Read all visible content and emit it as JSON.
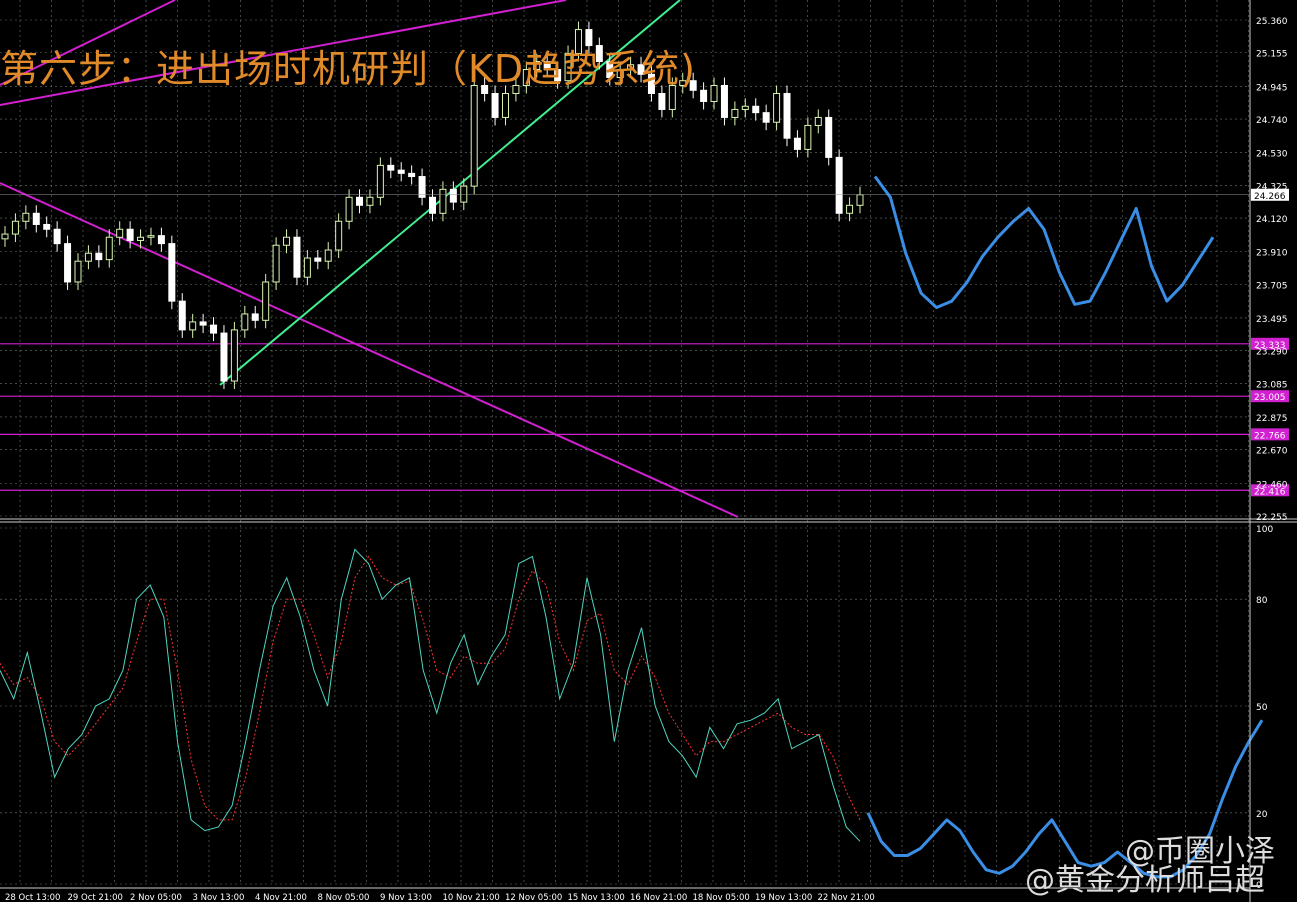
{
  "title": "第六步：进出场时机研判（KD趋势系统)",
  "watermark": {
    "line1": "@币圈小泽",
    "line2": "@黄金分析师吕超"
  },
  "colors": {
    "bg": "#000000",
    "grid": "#6b7a6b",
    "up": "#d8f5b0",
    "down": "#ffffff",
    "magenta": "#d020d0",
    "trend": "#40f090",
    "forecast": "#3a8ee6",
    "k_line": "#4fd6c0",
    "d_line": "#ff3030",
    "axis_text": "#ffffff",
    "title": "#e08a2a"
  },
  "chart_data": [
    {
      "type": "candlestick",
      "price_axis": {
        "ylim": [
          22.255,
          25.36
        ],
        "ticks": [
          "25.360",
          "25.155",
          "24.945",
          "24.740",
          "24.530",
          "24.325",
          "24.120",
          "23.910",
          "23.705",
          "23.495",
          "23.290",
          "23.085",
          "22.875",
          "22.670",
          "22.460",
          "22.255"
        ],
        "current_price": "24.266"
      },
      "x_labels": [
        "28 Oct 13:00",
        "29 Oct 21:00",
        "2 Nov 05:00",
        "3 Nov 13:00",
        "4 Nov 21:00",
        "8 Nov 05:00",
        "9 Nov 13:00",
        "10 Nov 21:00",
        "12 Nov 05:00",
        "15 Nov 13:00",
        "16 Nov 21:00",
        "18 Nov 05:00",
        "19 Nov 13:00",
        "22 Nov 21:00"
      ],
      "horizontal_levels": [
        {
          "label": "23.333",
          "value": 23.333
        },
        {
          "label": "23.005",
          "value": 23.005
        },
        {
          "label": "22.766",
          "value": 22.766
        },
        {
          "label": "22.416",
          "value": 22.416
        }
      ],
      "closes": [
        24.02,
        24.1,
        24.15,
        24.08,
        24.05,
        23.96,
        23.72,
        23.85,
        23.9,
        23.86,
        24.0,
        24.05,
        23.98,
        24.0,
        24.01,
        23.96,
        23.6,
        23.42,
        23.47,
        23.45,
        23.4,
        23.1,
        23.42,
        23.52,
        23.48,
        23.72,
        23.95,
        24.0,
        23.75,
        23.87,
        23.85,
        23.92,
        24.1,
        24.25,
        24.2,
        24.25,
        24.45,
        24.42,
        24.4,
        24.38,
        24.25,
        24.15,
        24.3,
        24.22,
        24.32,
        24.95,
        24.9,
        24.75,
        24.9,
        24.95,
        25.05,
        25.1,
        25.05,
        24.98,
        25.15,
        25.3,
        25.2,
        25.1,
        25.0,
        25.05,
        25.08,
        25.02,
        24.9,
        24.8,
        24.95,
        24.98,
        24.92,
        24.85,
        24.95,
        24.75,
        24.8,
        24.82,
        24.78,
        24.72,
        24.9,
        24.62,
        24.55,
        24.7,
        24.75,
        24.5,
        24.15,
        24.2,
        24.266
      ],
      "trend_lines": "magenta channel upper line, magenta descending line, green rising channel line",
      "forecast": [
        24.38,
        24.25,
        23.9,
        23.65,
        23.56,
        23.6,
        23.72,
        23.88,
        24.0,
        24.1,
        24.18,
        24.05,
        23.78,
        23.58,
        23.6,
        23.78,
        23.98,
        24.18,
        23.82,
        23.6,
        23.7,
        23.85,
        24.0
      ]
    },
    {
      "type": "line",
      "name": "KD oscillator",
      "ylim": [
        0,
        100
      ],
      "ticks": [
        "100",
        "80",
        "50",
        "20",
        "0"
      ],
      "series": [
        {
          "values": [
            60,
            52,
            65,
            48,
            30,
            38,
            42,
            50,
            52,
            60,
            80,
            84,
            75,
            40,
            18,
            15,
            16,
            22,
            40,
            60,
            78,
            86,
            75,
            60,
            50,
            80,
            94,
            90,
            80,
            84,
            86,
            60,
            48,
            62,
            70,
            56,
            64,
            70,
            90,
            92,
            75,
            52,
            62,
            86,
            70,
            40,
            60,
            72,
            50,
            40,
            36,
            30,
            44,
            38,
            45,
            46,
            48,
            52,
            38,
            40,
            42,
            28,
            16,
            12
          ]
        },
        {
          "values": [
            62,
            56,
            58,
            52,
            40,
            36,
            40,
            45,
            50,
            55,
            68,
            80,
            80,
            60,
            35,
            22,
            18,
            18,
            30,
            48,
            68,
            80,
            80,
            70,
            58,
            68,
            86,
            92,
            86,
            84,
            85,
            74,
            60,
            58,
            64,
            62,
            62,
            66,
            80,
            88,
            84,
            68,
            60,
            74,
            76,
            60,
            56,
            64,
            58,
            48,
            42,
            36,
            40,
            40,
            42,
            44,
            46,
            48,
            44,
            42,
            42,
            36,
            26,
            18
          ]
        }
      ],
      "forecast": [
        20,
        12,
        8,
        8,
        10,
        14,
        18,
        15,
        9,
        4,
        3,
        5,
        9,
        14,
        18,
        12,
        6,
        5,
        6,
        9,
        6,
        3,
        2,
        2,
        4,
        8,
        14,
        24,
        33,
        40,
        46
      ]
    }
  ]
}
